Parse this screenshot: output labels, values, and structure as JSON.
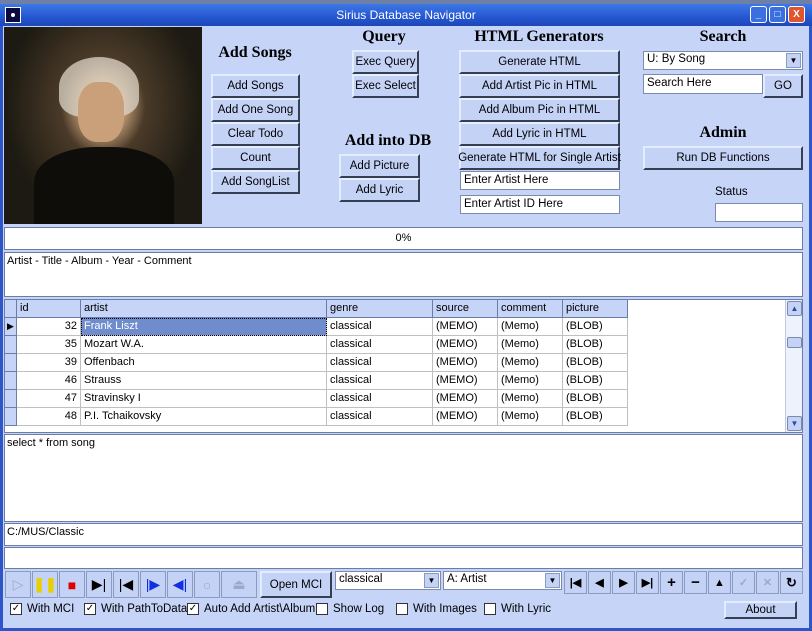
{
  "window": {
    "title": "Sirius Database Navigator",
    "minimize": "_",
    "maximize": "□",
    "close": "X"
  },
  "add_songs": {
    "heading": "Add Songs",
    "buttons": [
      "Add Songs",
      "Add One Song",
      "Clear Todo",
      "Count",
      "Add SongList"
    ]
  },
  "query": {
    "heading": "Query",
    "buttons": [
      "Exec Query",
      "Exec Select"
    ]
  },
  "add_into_db": {
    "heading": "Add into DB",
    "buttons": [
      "Add Picture",
      "Add Lyric"
    ]
  },
  "html_generators": {
    "heading": "HTML Generators",
    "buttons": [
      "Generate HTML",
      "Add Artist Pic in HTML",
      "Add Album Pic in HTML",
      "Add Lyric in HTML",
      "Generate HTML for Single Artist"
    ],
    "artist_input": "Enter Artist Here",
    "artist_id_input": "Enter Artist ID Here"
  },
  "search": {
    "heading": "Search",
    "mode": "U: By Song",
    "input": "Search Here",
    "go": "GO"
  },
  "admin": {
    "heading": "Admin",
    "run": "Run DB Functions",
    "status_label": "Status",
    "status_value": ""
  },
  "progress": {
    "label": "0%",
    "value": 0
  },
  "info_memo": "Artist - Title - Album - Year - Comment",
  "grid": {
    "columns": [
      "id",
      "artist",
      "genre",
      "source",
      "comment",
      "picture"
    ],
    "rows": [
      [
        "32",
        "Frank Liszt",
        "classical",
        "(MEMO)",
        "(Memo)",
        "(BLOB)"
      ],
      [
        "35",
        "Mozart W.A.",
        "classical",
        "(MEMO)",
        "(Memo)",
        "(BLOB)"
      ],
      [
        "39",
        "Offenbach",
        "classical",
        "(MEMO)",
        "(Memo)",
        "(BLOB)"
      ],
      [
        "46",
        "Strauss",
        "classical",
        "(MEMO)",
        "(Memo)",
        "(BLOB)"
      ],
      [
        "47",
        "Stravinsky I",
        "classical",
        "(MEMO)",
        "(Memo)",
        "(BLOB)"
      ],
      [
        "48",
        "P.I. Tchaikovsky",
        "classical",
        "(MEMO)",
        "(Memo)",
        "(BLOB)"
      ]
    ],
    "selected_row": 0
  },
  "sql_memo": "select * from song",
  "path": "C:/MUS/Classic",
  "extra_field": "",
  "toolbar": {
    "open_mci": "Open MCI",
    "genre_combo": "classical",
    "sort_combo": "A: Artist"
  },
  "checkboxes": [
    {
      "label": "With MCI",
      "checked": true
    },
    {
      "label": "With PathToData",
      "checked": true
    },
    {
      "label": "Auto Add Artist\\Album",
      "checked": true
    },
    {
      "label": "Show Log",
      "checked": false
    },
    {
      "label": "With Images",
      "checked": false
    },
    {
      "label": "With Lyric",
      "checked": false
    }
  ],
  "about": "About"
}
